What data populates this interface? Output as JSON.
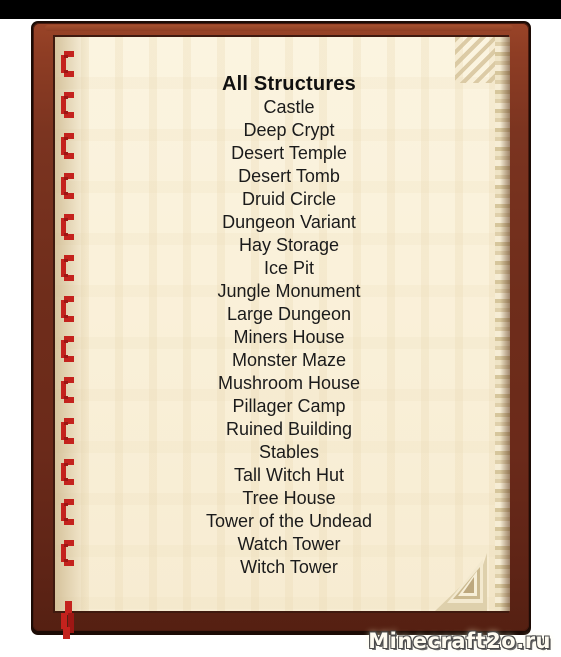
{
  "window": {
    "background_color": "#ffffff",
    "letterbox_color": "#000000"
  },
  "book": {
    "cover_color": "#6b2a1a",
    "cover_highlight_color": "#9a4428",
    "page_color": "#faf2dc",
    "page_edge_color": "#dfd0ab",
    "ring_color": "#c4221d",
    "ring_count": 14
  },
  "page_content": {
    "title": "All Structures",
    "structures": [
      "Castle",
      "Deep Crypt",
      "Desert Temple",
      "Desert Tomb",
      "Druid Circle",
      "Dungeon Variant",
      "Hay Storage",
      "Ice Pit",
      "Jungle Monument",
      "Large Dungeon",
      "Miners House",
      "Monster Maze",
      "Mushroom House",
      "Pillager Camp",
      "Ruined Building",
      "Stables",
      "Tall Witch Hut",
      "Tree House",
      "Tower of the Undead",
      "Watch Tower",
      "Witch Tower"
    ]
  },
  "watermark": {
    "text": "Minecraft2o.ru",
    "text_color": "#fefbf0",
    "outline_color": "#4a4a4a"
  }
}
